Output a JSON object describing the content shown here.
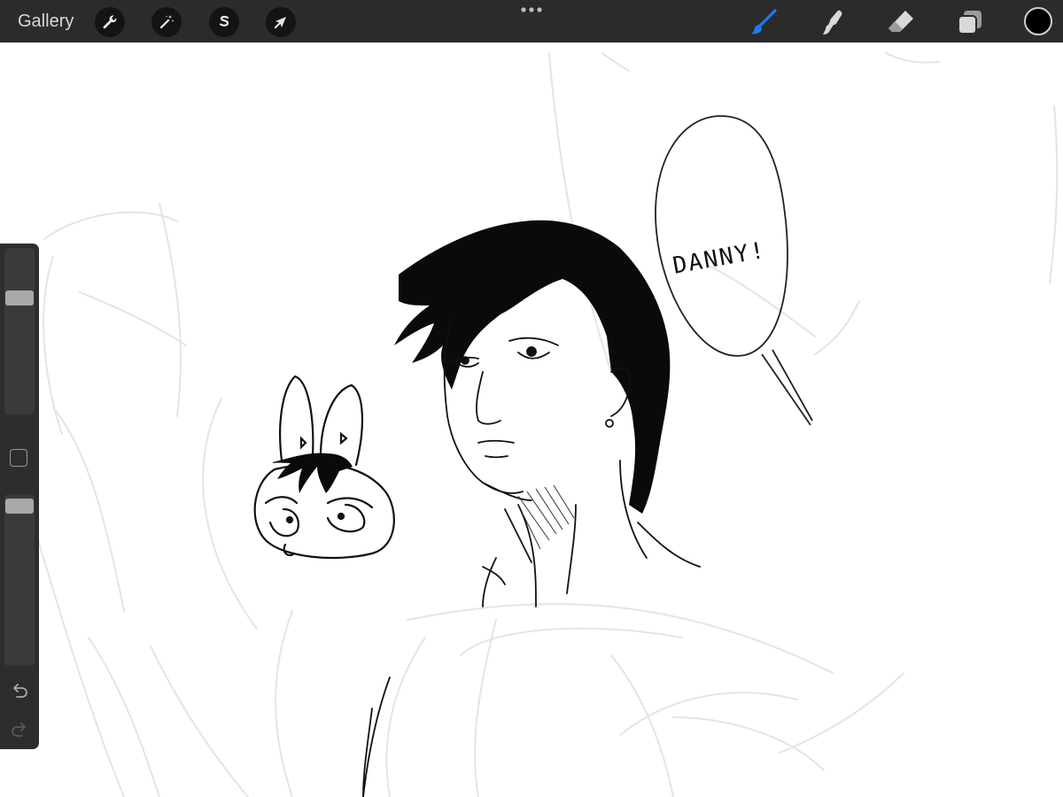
{
  "topbar": {
    "gallery_label": "Gallery",
    "left_tools": [
      {
        "name": "actions",
        "icon": "wrench-icon"
      },
      {
        "name": "adjustments",
        "icon": "magic-wand-icon"
      },
      {
        "name": "selection",
        "icon": "selection-s-icon"
      },
      {
        "name": "transform",
        "icon": "arrow-cursor-icon"
      }
    ],
    "more_menu_icon": "ellipsis-icon",
    "right_tools": [
      {
        "name": "brush",
        "icon": "brush-icon",
        "active": true
      },
      {
        "name": "smudge",
        "icon": "smudge-finger-icon",
        "active": false
      },
      {
        "name": "eraser",
        "icon": "eraser-icon",
        "active": false
      },
      {
        "name": "layers",
        "icon": "layers-icon",
        "active": false
      }
    ],
    "current_color": "#000000",
    "active_tool_color": "#1a7cf0"
  },
  "sidebar": {
    "brush_size_level": 0.72,
    "opacity_level": 0.97,
    "undo_icon": "undo-icon",
    "redo_icon": "redo-icon",
    "modify_icon": "square-modify-icon"
  },
  "canvas": {
    "speech_bubble_text": "DANNY!"
  }
}
